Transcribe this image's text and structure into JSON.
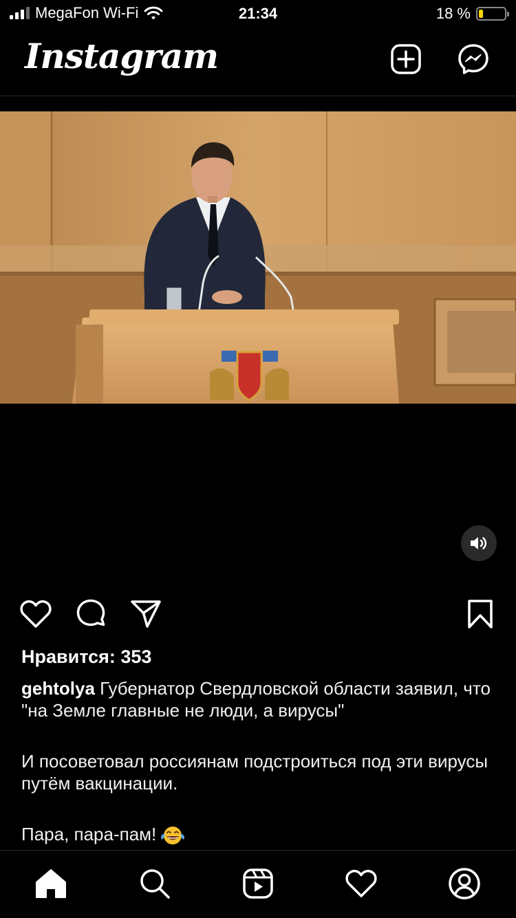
{
  "status_bar": {
    "carrier": "MegaFon Wi-Fi",
    "time": "21:34",
    "battery_percent_text": "18 %",
    "battery_level": 0.18,
    "icons": [
      "signal-icon",
      "wifi-icon",
      "battery-icon"
    ]
  },
  "header": {
    "logo": "Instagram",
    "icons": [
      "new-post-icon",
      "messenger-icon"
    ]
  },
  "post": {
    "media_type": "video",
    "sound_icon": "speaker-icon",
    "actions": [
      "heart-icon",
      "comment-icon",
      "send-icon",
      "bookmark-icon"
    ],
    "likes_text": "Нравится: 353",
    "username": "gehtolya",
    "caption_first": " Губернатор Свердловской области заявил, что \"на Земле главные не люди, а вирусы\"",
    "caption_second": "И посоветовал россиянам подстроиться под эти вирусы путём вакцинации.",
    "caption_third": "Пара, пара-пам!",
    "caption_emoji": "face-with-tears-of-joy"
  },
  "tab_bar": {
    "active": "home",
    "icons": [
      "home-icon",
      "search-icon",
      "reels-icon",
      "heart-icon",
      "profile-icon"
    ]
  },
  "colors": {
    "background": "#000000",
    "text": "#ffffff",
    "battery_fill": "#ffd60a",
    "divider": "#262626"
  }
}
